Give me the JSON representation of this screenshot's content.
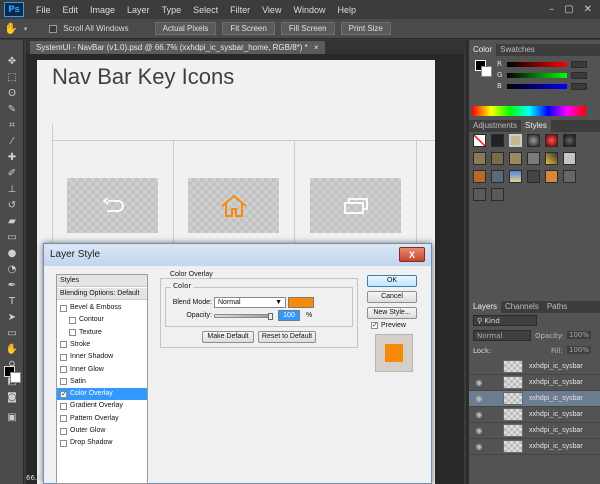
{
  "app": {
    "logo": "Ps",
    "menu": [
      "File",
      "Edit",
      "Image",
      "Layer",
      "Type",
      "Select",
      "Filter",
      "View",
      "Window",
      "Help"
    ],
    "window_controls": [
      "–",
      "▢",
      "✕"
    ]
  },
  "options_bar": {
    "scroll_all_windows": "Scroll All Windows",
    "buttons": [
      "Actual Pixels",
      "Fit Screen",
      "Fill Screen",
      "Print Size"
    ]
  },
  "document": {
    "tab_title": "SystemUI - NavBar (v1.0).psd @ 66.7% (xxhdpi_ic_sysbar_home, RGB/8*) *",
    "canvas_title": "Nav Bar Key Icons",
    "zoom_status": "66.67"
  },
  "panels": {
    "color_tabs": [
      "Color",
      "Swatches"
    ],
    "color_slider_labels": [
      "R",
      "G",
      "B"
    ],
    "styles_tabs": [
      "Adjustments",
      "Styles"
    ],
    "layers_tabs": [
      "Layers",
      "Channels",
      "Paths"
    ],
    "kind_label": "Kind",
    "blend_mode": "Normal",
    "opacity_label": "Opacity:",
    "opacity_value": "100%",
    "lock_label": "Lock:",
    "fill_label": "Fill:",
    "fill_value": "100%",
    "layers": [
      "xxhdpi_ic_sysbar",
      "xxhdpi_ic_sysbar",
      "xxhdpi_ic_sysbar",
      "xxhdpi_ic_sysbar",
      "xxhdpi_ic_sysbar",
      "xxhdpi_ic_sysbar"
    ]
  },
  "dialog": {
    "title": "Layer Style",
    "close_label": "X",
    "styles_header": "Styles",
    "blending_options": "Blending Options: Default",
    "effects": [
      {
        "label": "Bevel & Emboss",
        "checked": false,
        "indent": false
      },
      {
        "label": "Contour",
        "checked": false,
        "indent": true
      },
      {
        "label": "Texture",
        "checked": false,
        "indent": true
      },
      {
        "label": "Stroke",
        "checked": false,
        "indent": false
      },
      {
        "label": "Inner Shadow",
        "checked": false,
        "indent": false
      },
      {
        "label": "Inner Glow",
        "checked": false,
        "indent": false
      },
      {
        "label": "Satin",
        "checked": false,
        "indent": false
      },
      {
        "label": "Color Overlay",
        "checked": true,
        "indent": false
      },
      {
        "label": "Gradient Overlay",
        "checked": false,
        "indent": false
      },
      {
        "label": "Pattern Overlay",
        "checked": false,
        "indent": false
      },
      {
        "label": "Outer Glow",
        "checked": false,
        "indent": false
      },
      {
        "label": "Drop Shadow",
        "checked": false,
        "indent": false
      }
    ],
    "section_title": "Color Overlay",
    "group_title": "Color",
    "blend_mode_label": "Blend Mode:",
    "blend_mode_value": "Normal",
    "opacity_label": "Opacity:",
    "opacity_value": "100",
    "opacity_unit": "%",
    "opacity_fraction": 1.0,
    "make_default": "Make Default",
    "reset_default": "Reset to Default",
    "ok": "OK",
    "cancel": "Cancel",
    "new_style": "New Style...",
    "preview_label": "Preview",
    "preview_checked": true,
    "overlay_color": "#f7890b"
  }
}
